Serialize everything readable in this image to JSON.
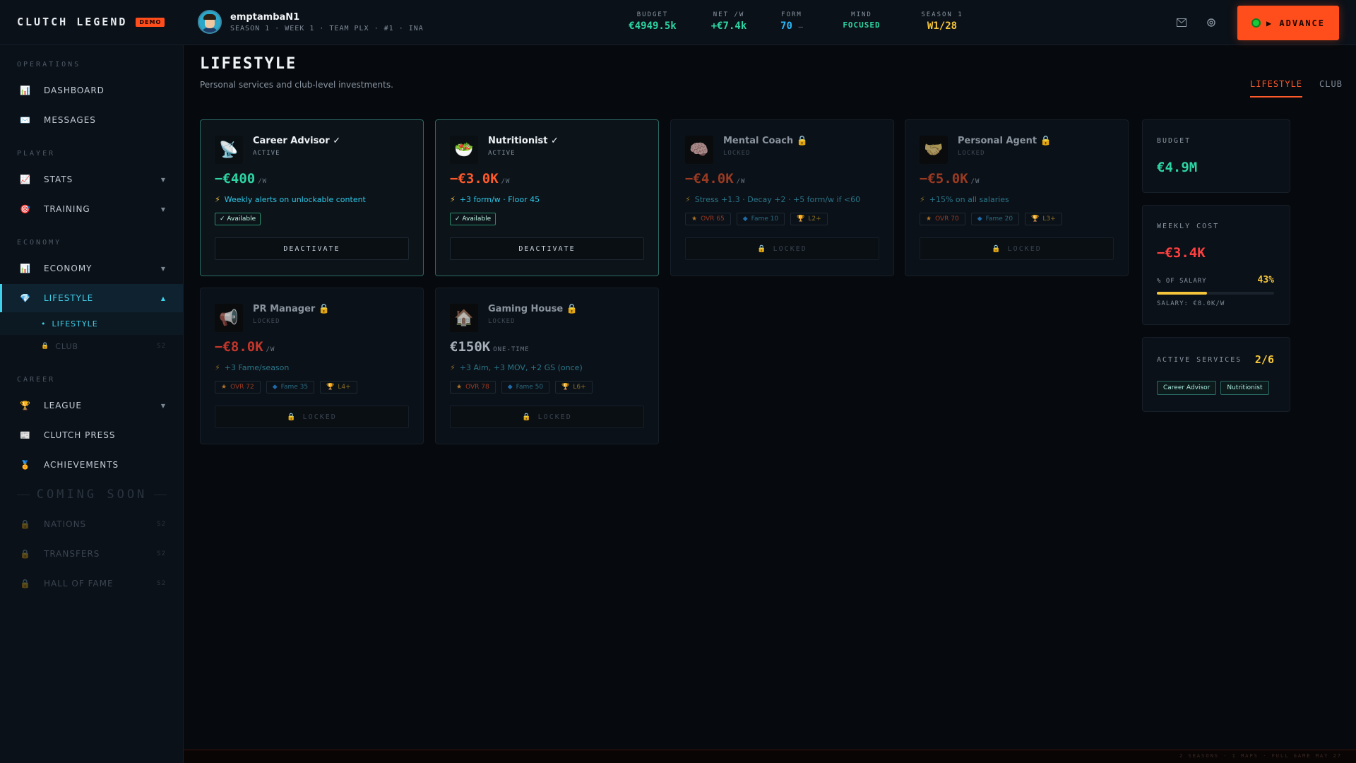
{
  "app": {
    "brand": "CLUTCH LEGEND",
    "badge": "DEMO"
  },
  "profile": {
    "username": "emptambaN1",
    "subtitle": "SEASON 1 · WEEK 1 · TEAM PLX · #1 · INA"
  },
  "stats": {
    "budget": {
      "label": "BUDGET",
      "value": "€4949.5k"
    },
    "net": {
      "label": "NET /W",
      "value": "+€7.4k"
    },
    "form": {
      "label": "FORM",
      "value": "70",
      "trend": "–"
    },
    "mind": {
      "label": "MIND",
      "value": "FOCUSED"
    },
    "season": {
      "label": "SEASON 1",
      "value": "W1/28"
    }
  },
  "top_icons": [
    "mail-icon",
    "settings-icon"
  ],
  "advance": {
    "label": "▶ ADVANCE"
  },
  "sidebar": {
    "sections": {
      "operations": "OPERATIONS",
      "player": "PLAYER",
      "economy": "ECONOMY",
      "career": "CAREER"
    },
    "items": {
      "dashboard": "DASHBOARD",
      "messages": "MESSAGES",
      "stats": "STATS",
      "training": "TRAINING",
      "economy": "ECONOMY",
      "lifestyle": "LIFESTYLE",
      "lifestyle_sub": "LIFESTYLE",
      "club_sub": "CLUB",
      "league": "LEAGUE",
      "clutch_press": "CLUTCH PRESS",
      "achievements": "ACHIEVEMENTS",
      "nations": "NATIONS",
      "transfers": "TRANSFERS",
      "hall_of_fame": "HALL OF FAME"
    },
    "coming_soon": "COMING SOON",
    "lock_tag": "S2"
  },
  "page": {
    "title": "LIFESTYLE",
    "subtitle": "Personal services and club-level investments.",
    "tabs": [
      "LIFESTYLE",
      "CLUB"
    ]
  },
  "cards": [
    {
      "name": "Career Advisor ✓",
      "status": "ACTIVE",
      "price": "−€400",
      "unit": "/W",
      "effect": "Weekly alerts on unlockable content",
      "badge": "✓ Available",
      "button": "DEACTIVATE",
      "icon": "satellite-dish-icon"
    },
    {
      "name": "Nutritionist ✓",
      "status": "ACTIVE",
      "price": "−€3.0K",
      "unit": "/W",
      "effect": "+3 form/w · Floor 45",
      "badge": "✓ Available",
      "button": "DEACTIVATE",
      "icon": "salad-bowl-icon"
    },
    {
      "name": "Mental Coach 🔒",
      "status": "LOCKED",
      "price": "−€4.0K",
      "unit": "/W",
      "effect": "Stress +1.3 · Decay +2 · +5 form/w if <60",
      "reqs": [
        "OVR 65",
        "Fame 10",
        "L2+"
      ],
      "button": "🔒 LOCKED",
      "icon": "brain-icon"
    },
    {
      "name": "Personal Agent 🔒",
      "status": "LOCKED",
      "price": "−€5.0K",
      "unit": "/W",
      "effect": "+15% on all salaries",
      "reqs": [
        "OVR 70",
        "Fame 20",
        "L3+"
      ],
      "button": "🔒 LOCKED",
      "icon": "handshake-icon"
    },
    {
      "name": "PR Manager 🔒",
      "status": "LOCKED",
      "price": "−€8.0K",
      "unit": "/W",
      "effect": "+3 Fame/season",
      "reqs": [
        "OVR 72",
        "Fame 35",
        "L4+"
      ],
      "button": "🔒 LOCKED",
      "icon": "megaphone-icon"
    },
    {
      "name": "Gaming House 🔒",
      "status": "LOCKED",
      "price": "€150K",
      "unit": "ONE-TIME",
      "effect": "+3 Aim, +3 MOV, +2 GS (once)",
      "reqs": [
        "OVR 78",
        "Fame 50",
        "L6+"
      ],
      "button": "🔒 LOCKED",
      "icon": "house-icon"
    }
  ],
  "panels": {
    "budget": {
      "label": "BUDGET",
      "value": "€4.9M"
    },
    "weekly": {
      "label": "WEEKLY COST",
      "value": "−€3.4K",
      "salary_label": "% OF SALARY",
      "salary_pct": "43%",
      "salary_fraction": 0.43,
      "salary": "SALARY: €8.0K/W"
    },
    "active": {
      "label": "ACTIVE SERVICES",
      "count": "2/6",
      "tags": [
        "Career Advisor",
        "Nutritionist"
      ]
    }
  },
  "footer": "2 SEASONS · 1 MAPS · FULL GAME MAY 27",
  "colors": {
    "accent": "#ff4d1c",
    "cyan": "#3fd0ea",
    "green": "#2dd4a3",
    "gold": "#f5c63c"
  }
}
